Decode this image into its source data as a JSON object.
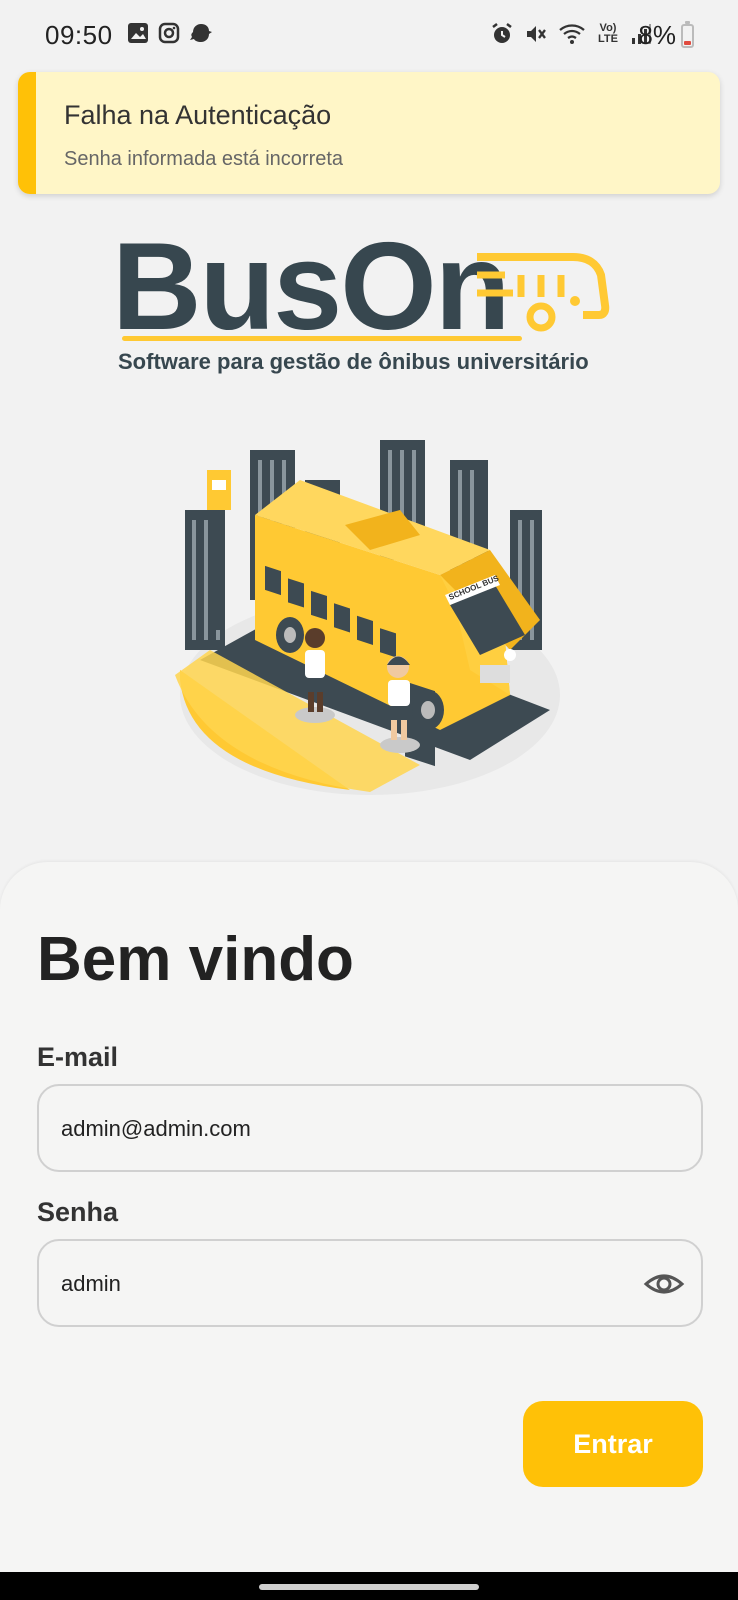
{
  "status_bar": {
    "time": "09:50",
    "battery": "8%",
    "network_lte_label": "Vo) LTE",
    "left_icons": [
      "gallery-icon",
      "instagram-icon",
      "app-icon"
    ],
    "right_icons": [
      "alarm-icon",
      "mute-icon",
      "wifi-icon",
      "volte-icon",
      "signal-icon"
    ]
  },
  "alert": {
    "title": "Falha na Autenticação",
    "message": "Senha informada está incorreta",
    "accent_color": "#ffc107",
    "background_color": "#fff6c7"
  },
  "logo": {
    "name": "BusOn",
    "tagline": "Software para gestão de ônibus universitário",
    "colors": {
      "text": "#37474f",
      "accent": "#ffc933"
    }
  },
  "illustration": {
    "bus_sign": "SCHOOL BUS"
  },
  "login": {
    "heading": "Bem vindo",
    "email_label": "E-mail",
    "email_value": "admin@admin.com",
    "password_label": "Senha",
    "password_value": "admin",
    "submit_label": "Entrar",
    "primary_color": "#ffc107"
  }
}
